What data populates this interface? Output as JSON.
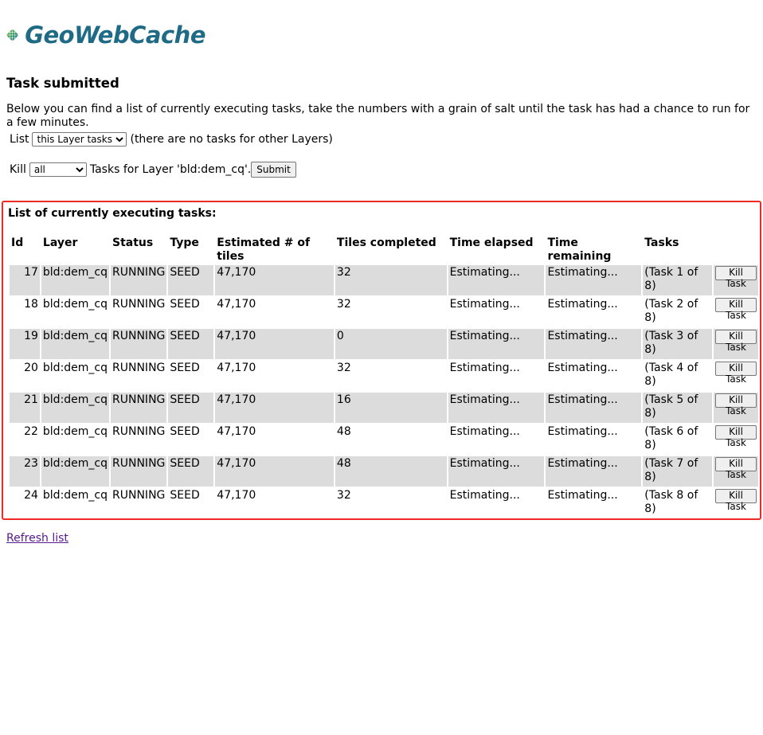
{
  "logo": {
    "text": "GeoWebCache"
  },
  "title": "Task submitted",
  "intro": "Below you can find a list of currently executing tasks, take the numbers with a grain of salt until the task has had a chance to run for a few minutes.",
  "list_control": {
    "label": "List",
    "selected": "this Layer tasks",
    "note": "(there are no tasks for other Layers)"
  },
  "kill_control": {
    "label": "Kill",
    "selected": "all",
    "suffix": "Tasks for Layer 'bld:dem_cq'.",
    "submit": "Submit"
  },
  "tasks_box": {
    "title": "List of currently executing tasks:",
    "headers": [
      "Id",
      "Layer",
      "Status",
      "Type",
      "Estimated # of tiles",
      "Tiles completed",
      "Time elapsed",
      "Time remaining",
      "Tasks"
    ],
    "kill_label": "Kill Task",
    "rows": [
      {
        "id": "17",
        "layer": "bld:dem_cq",
        "status": "RUNNING",
        "type": "SEED",
        "estimated": "47,170",
        "completed": "32",
        "elapsed": "Estimating...",
        "remaining": "Estimating...",
        "task": "(Task 1 of 8)"
      },
      {
        "id": "18",
        "layer": "bld:dem_cq",
        "status": "RUNNING",
        "type": "SEED",
        "estimated": "47,170",
        "completed": "32",
        "elapsed": "Estimating...",
        "remaining": "Estimating...",
        "task": "(Task 2 of 8)"
      },
      {
        "id": "19",
        "layer": "bld:dem_cq",
        "status": "RUNNING",
        "type": "SEED",
        "estimated": "47,170",
        "completed": "0",
        "elapsed": "Estimating...",
        "remaining": "Estimating...",
        "task": "(Task 3 of 8)"
      },
      {
        "id": "20",
        "layer": "bld:dem_cq",
        "status": "RUNNING",
        "type": "SEED",
        "estimated": "47,170",
        "completed": "32",
        "elapsed": "Estimating...",
        "remaining": "Estimating...",
        "task": "(Task 4 of 8)"
      },
      {
        "id": "21",
        "layer": "bld:dem_cq",
        "status": "RUNNING",
        "type": "SEED",
        "estimated": "47,170",
        "completed": "16",
        "elapsed": "Estimating...",
        "remaining": "Estimating...",
        "task": "(Task 5 of 8)"
      },
      {
        "id": "22",
        "layer": "bld:dem_cq",
        "status": "RUNNING",
        "type": "SEED",
        "estimated": "47,170",
        "completed": "48",
        "elapsed": "Estimating...",
        "remaining": "Estimating...",
        "task": "(Task 6 of 8)"
      },
      {
        "id": "23",
        "layer": "bld:dem_cq",
        "status": "RUNNING",
        "type": "SEED",
        "estimated": "47,170",
        "completed": "48",
        "elapsed": "Estimating...",
        "remaining": "Estimating...",
        "task": "(Task 7 of 8)"
      },
      {
        "id": "24",
        "layer": "bld:dem_cq",
        "status": "RUNNING",
        "type": "SEED",
        "estimated": "47,170",
        "completed": "32",
        "elapsed": "Estimating...",
        "remaining": "Estimating...",
        "task": "(Task 8 of 8)"
      }
    ]
  },
  "refresh_link": "Refresh list",
  "colors": {
    "highlight_border": "#ee2a24",
    "row_stripe": "#dcdcdc",
    "logo_text": "#1f6b86"
  }
}
